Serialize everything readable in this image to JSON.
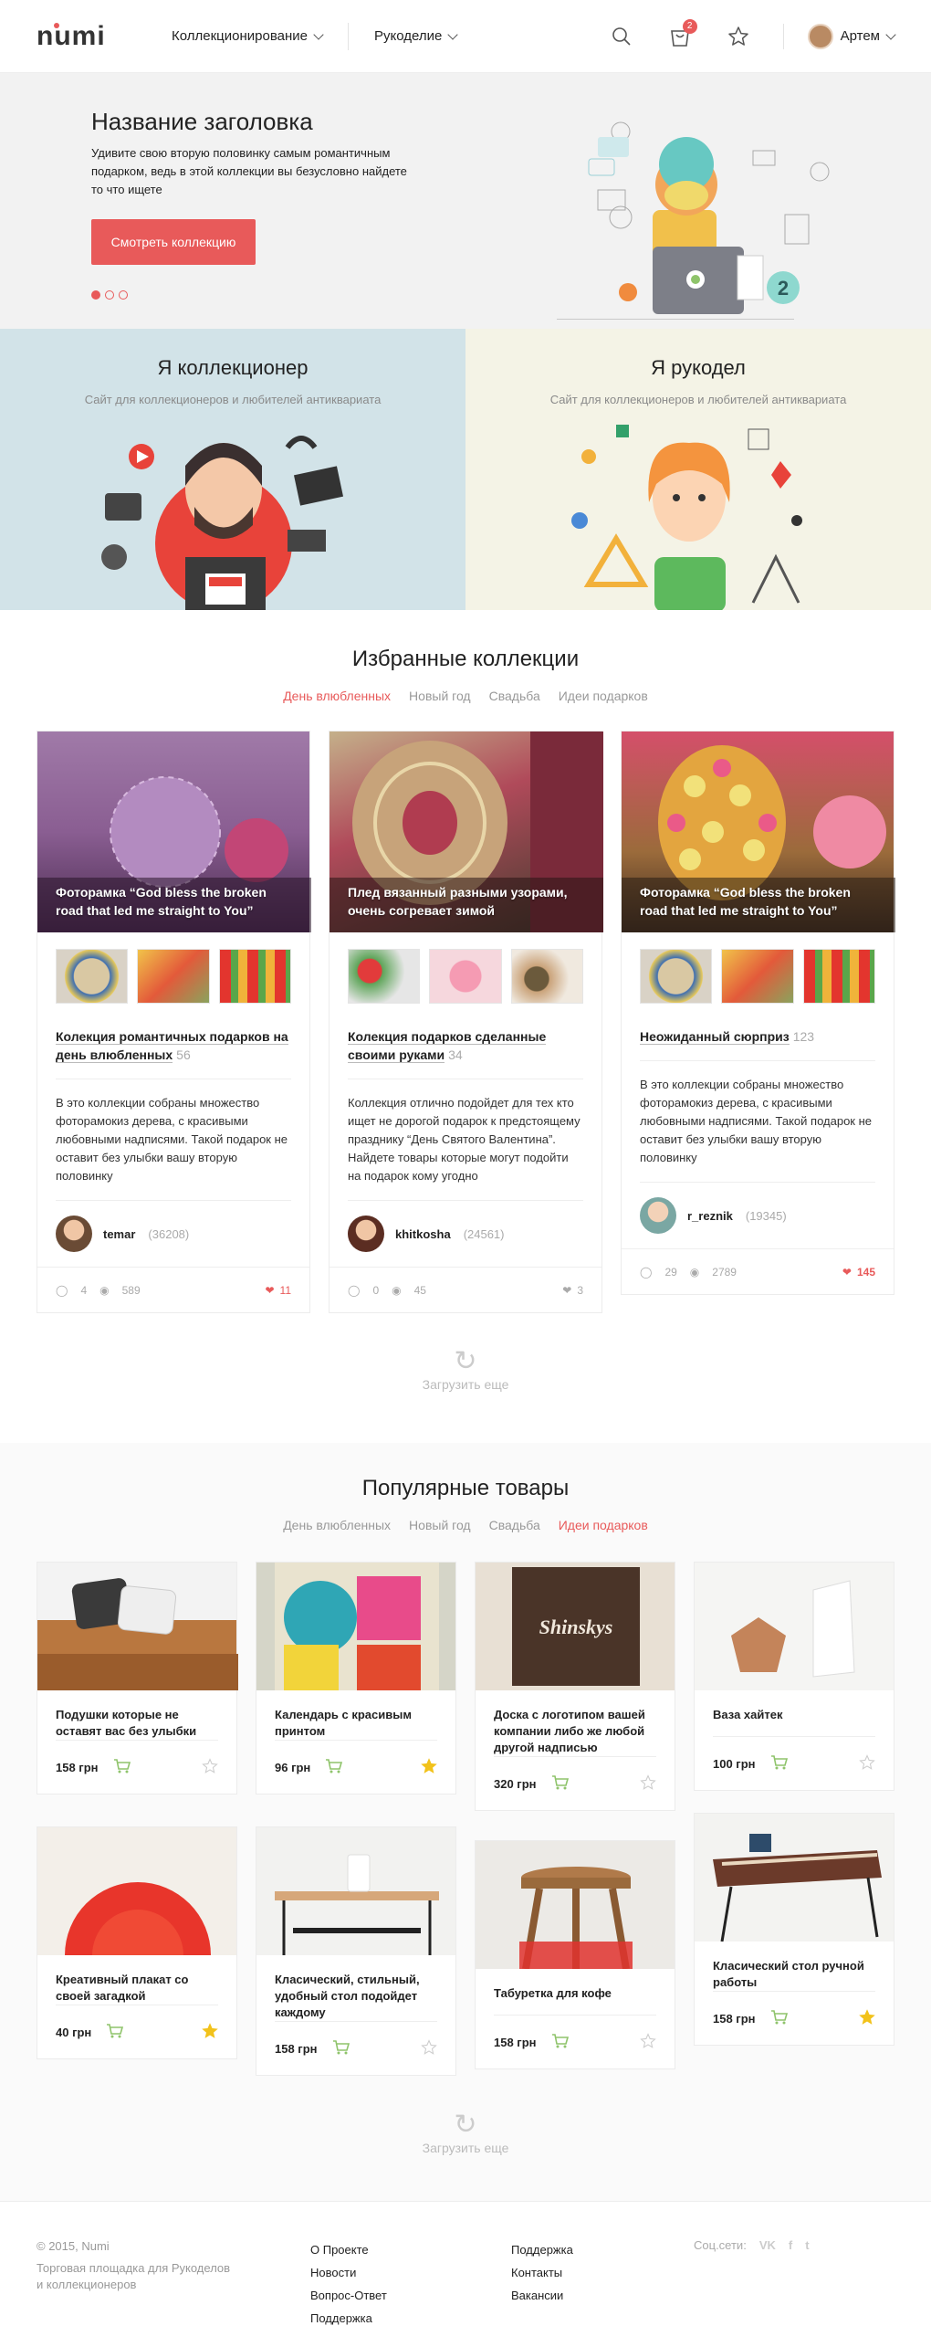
{
  "header": {
    "logo": "numi",
    "nav": [
      "Коллекционирование",
      "Рукоделие"
    ],
    "cart_count": "2",
    "user_name": "Артем"
  },
  "hero": {
    "title": "Название заголовка",
    "text": "Удивите свою вторую половинку самым романтичным подарком, ведь в этой коллекции вы безусловно найдете то что ищете",
    "button": "Смотреть коллекцию",
    "badge_number": "2"
  },
  "split": [
    {
      "title": "Я коллекционер",
      "subtitle": "Сайт для коллекционеров и любителей антиквариата"
    },
    {
      "title": "Я рукодел",
      "subtitle": "Сайт для коллекционеров и любителей антиквариата"
    }
  ],
  "featured": {
    "title": "Избранные коллекции",
    "tabs": [
      "День влюбленных",
      "Новый год",
      "Свадьба",
      "Идеи подарков"
    ],
    "active_tab": 0,
    "cards": [
      {
        "caption": "Фоторамка “God bless the broken road that led me straight to You”",
        "title": "Колекция романтичных подарков на день влюбленных",
        "count": "56",
        "desc": "В это коллекции собраны множество фоторамокиз дерева, с красивыми любовными надписями. Такой подарок не оставит без улыбки вашу вторую половинку",
        "author": "temar",
        "author_count": "(36208)",
        "comments": "4",
        "views": "589",
        "likes": "11"
      },
      {
        "caption": "Плед вязанный разными узорами, очень согревает зимой",
        "title": "Колекция подарков сделанные своими руками",
        "count": "34",
        "desc": "Коллекция отлично подойдет для тех кто ищет не дорогой подарок к предстоящему празднику “День Святого Валентина”. Найдете товары которые могут подойти на подарок кому угодно",
        "author": "khitkosha",
        "author_count": "(24561)",
        "comments": "0",
        "views": "45",
        "likes": "3"
      },
      {
        "caption": "Фоторамка “God bless the broken road that led me straight to You”",
        "title": "Неожиданный сюрприз",
        "count": "123",
        "desc": "В это коллекции собраны множество фоторамокиз дерева, с красивыми любовными надписями. Такой подарок не оставит без улыбки вашу вторую половинку",
        "author": "r_reznik",
        "author_count": "(19345)",
        "comments": "29",
        "views": "2789",
        "likes": "145"
      }
    ],
    "load_more": "Загрузить еще"
  },
  "popular": {
    "title": "Популярные товары",
    "tabs": [
      "День влюбленных",
      "Новый год",
      "Свадьба",
      "Идеи подарков"
    ],
    "active_tab": 3,
    "items": [
      {
        "name": "Подушки которые не оставят вас без улыбки",
        "price": "158 грн",
        "fav": false
      },
      {
        "name": "Календарь с красивым принтом",
        "price": "96 грн",
        "fav": true
      },
      {
        "name": "Доска с логотипом вашей компании либо же любой другой надписью",
        "price": "320 грн",
        "fav": false
      },
      {
        "name": "Ваза хайтек",
        "price": "100 грн",
        "fav": false
      },
      {
        "name": "Креативный плакат со своей загадкой",
        "price": "40 грн",
        "fav": true
      },
      {
        "name": "Класический, стильный, удобный стол подойдет каждому",
        "price": "158 грн",
        "fav": false
      },
      {
        "name": "Табуретка для кофе",
        "price": "158 грн",
        "fav": false
      },
      {
        "name": "Класический стол ручной работы",
        "price": "158 грн",
        "fav": true
      }
    ],
    "load_more": "Загрузить еще",
    "board_text": "Shinskys"
  },
  "footer": {
    "copy": "© 2015, Numi",
    "tagline": "Торговая площадка для Рукоделов и коллекционеров",
    "col1": [
      "О Проекте",
      "Новости",
      "Вопрос-Ответ",
      "Поддержка"
    ],
    "col2": [
      "Поддержка",
      "Контакты",
      "Вакансии"
    ],
    "social_label": "Соц.сети:",
    "social": [
      "VK",
      "f",
      "t"
    ]
  },
  "colors": {
    "accent": "#e85a5a",
    "collector_bg": "#d2e3e8",
    "crafter_bg": "#f4f3e6",
    "cart_icon": "#8fc46b",
    "star_active": "#f2c21b"
  }
}
